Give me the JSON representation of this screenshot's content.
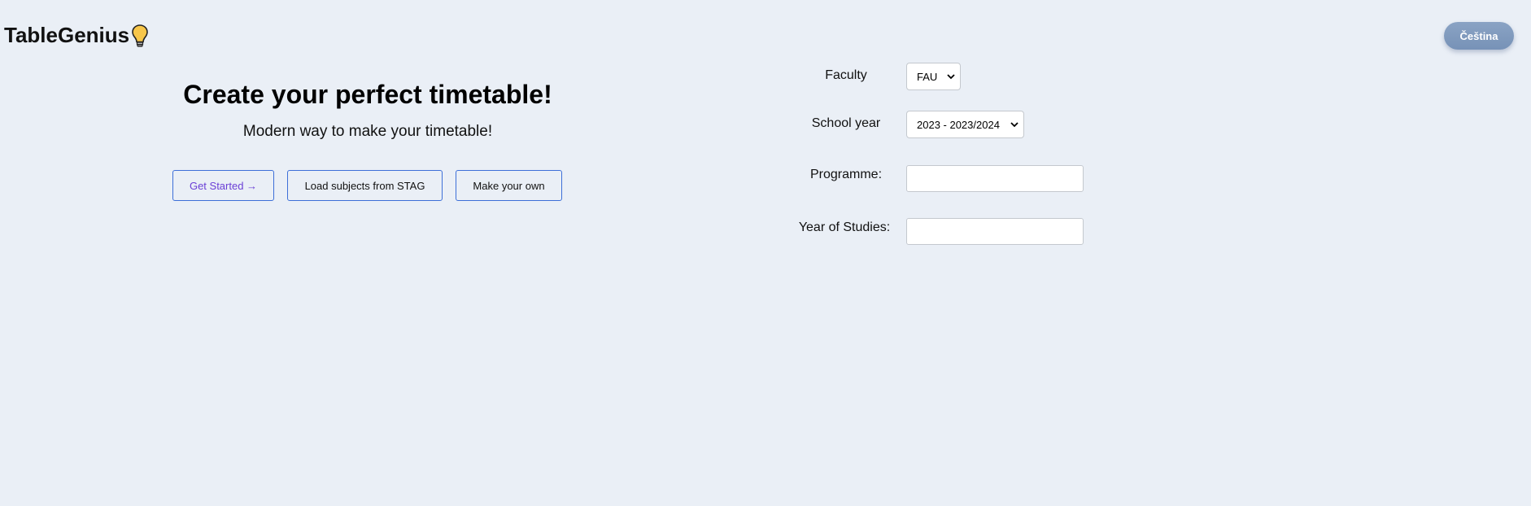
{
  "header": {
    "logo_text": "TableGenius",
    "logo_icon": "lightbulb-icon",
    "language_button": "Čeština"
  },
  "hero": {
    "title": "Create your perfect timetable!",
    "subtitle": "Modern way to make your timetable!",
    "buttons": {
      "get_started": "Get Started →",
      "load_stag": "Load subjects from STAG",
      "make_own": "Make your own"
    }
  },
  "form": {
    "faculty": {
      "label": "Faculty",
      "selected": "FAU"
    },
    "school_year": {
      "label": "School year",
      "selected": "2023 - 2023/2024"
    },
    "programme": {
      "label": "Programme:",
      "value": "",
      "placeholder": ""
    },
    "year_of_studies": {
      "label": "Year of Studies:",
      "value": "",
      "placeholder": ""
    }
  },
  "colors": {
    "background": "#eaeff6",
    "button_border": "#3d6fd8",
    "primary_text": "#6b3fd6",
    "language_button": "#8aa3c4"
  }
}
